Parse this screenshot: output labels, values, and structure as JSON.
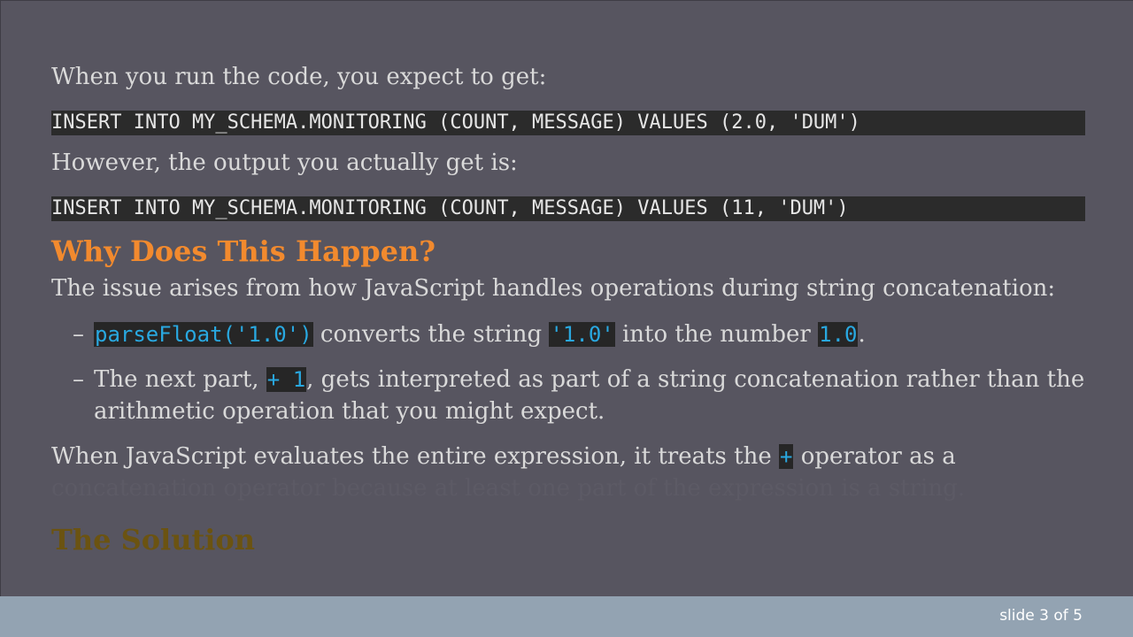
{
  "slide": {
    "intro_expected": "When you run the code, you expect to get:",
    "code_expected": "INSERT INTO MY_SCHEMA.MONITORING (COUNT, MESSAGE) VALUES (2.0, 'DUM')",
    "intro_actual": "However, the output you actually get is:",
    "code_actual": "INSERT INTO MY_SCHEMA.MONITORING (COUNT, MESSAGE) VALUES (11, 'DUM')",
    "heading_why": "Why Does This Happen?",
    "issue_text": "The issue arises from how JavaScript handles operations during string concatenation:",
    "bullet_dash": "–",
    "bullet1": {
      "code_parse": "parseFloat('1.0')",
      "text_a": " converts the string ",
      "code_string": "'1.0'",
      "text_b": " into the number ",
      "code_number": "1.0",
      "text_c": "."
    },
    "bullet2": {
      "text_a": "The next part, ",
      "code_plus_one": "+ 1",
      "text_b": ", gets interpreted as part of a string concatenation rather than the arithmetic operation that you might expect."
    },
    "evaluate_text_a": "When JavaScript evaluates the entire expression, it treats the ",
    "evaluate_code_plus": "+",
    "evaluate_text_b": " operator as a",
    "evaluate_text_faded": "concatenation operator because at least one part of the expression is a string.",
    "heading_solution": "The Solution"
  },
  "footer": {
    "slide_counter": "slide 3 of 5"
  },
  "colors": {
    "background": "#575560",
    "heading_accent": "#f28a2e",
    "inline_code": "#29a8e0",
    "footer_bar": "#93a3b2"
  }
}
